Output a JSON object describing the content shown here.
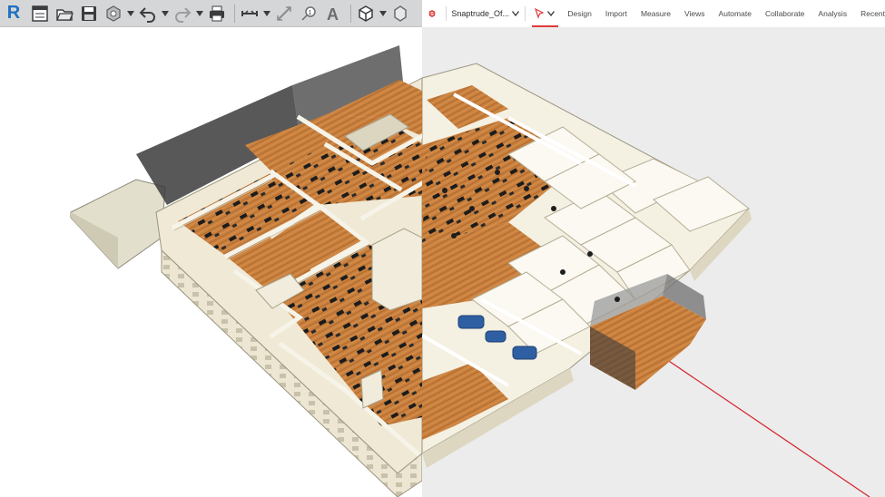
{
  "revit": {
    "logo_letter": "R",
    "accent": "#1e70c1",
    "toolbar_icons": [
      "properties-icon",
      "open-folder-icon",
      "save-icon",
      "sync-icon",
      "undo-icon",
      "redo-icon",
      "print-icon",
      "measure-icon",
      "dimension-icon",
      "tag-icon",
      "text-icon",
      "3d-view-icon"
    ],
    "text_tool_glyph": "A"
  },
  "snaptrude": {
    "brand_color": "#e03a3a",
    "project_name": "Snaptrude_Of...",
    "menu": [
      "Design",
      "Import",
      "Measure",
      "Views",
      "Automate",
      "Collaborate",
      "Analysis",
      "Recent"
    ]
  },
  "viewport": {
    "left_background": "#ffffff",
    "right_background": "#ececec",
    "axis_color": "#d4202a"
  }
}
